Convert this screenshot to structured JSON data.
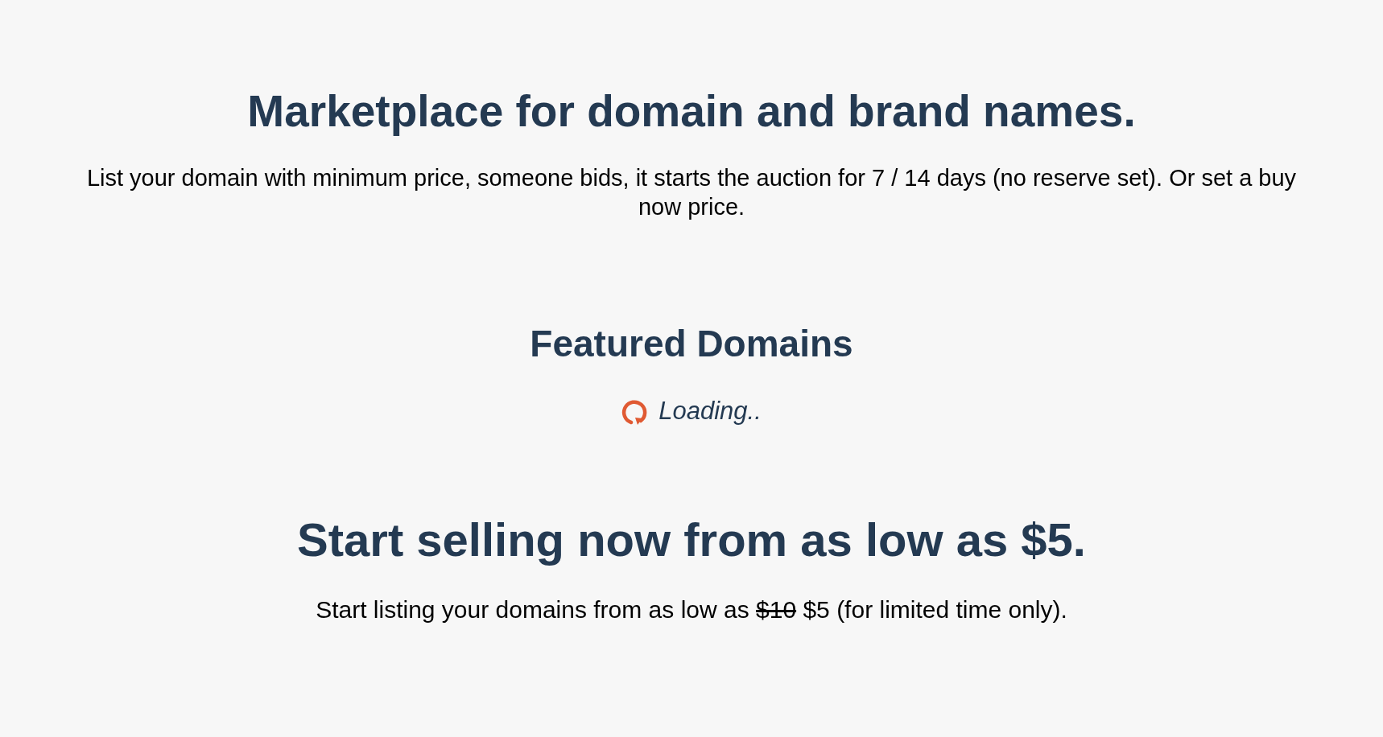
{
  "hero": {
    "title": "Marketplace for domain and brand names.",
    "description": "List your domain with minimum price, someone bids, it starts the auction for 7 / 14 days (no reserve set). Or set a buy now price."
  },
  "featured": {
    "title": "Featured Domains",
    "loading": {
      "text": "Loading..",
      "spinning": true
    }
  },
  "pricing": {
    "title": "Start selling now from as low as $5.",
    "text_before": "Start listing your domains from as low as",
    "old_price": "$10",
    "text_after": "$5 (for limited time only)."
  }
}
